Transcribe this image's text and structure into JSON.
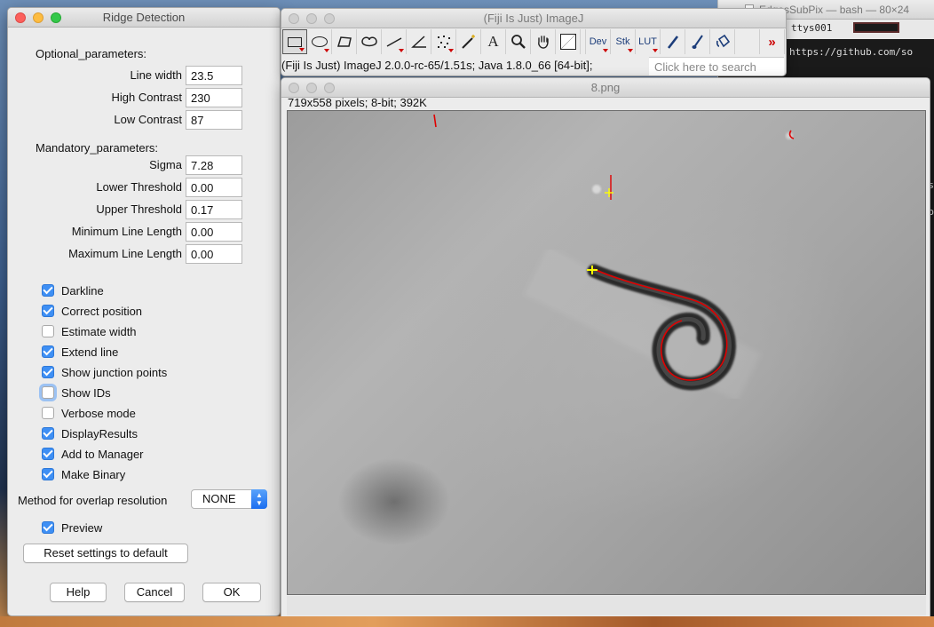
{
  "terminal": {
    "title": "EdgesSubPix — bash — 80×24",
    "tab": "ttys001",
    "url_fragment": "https://github.com/so",
    "caret1": "s",
    "caret2": "o"
  },
  "dialog": {
    "title": "Ridge Detection",
    "optional_label": "Optional_parameters:",
    "optional": [
      {
        "label": "Line width",
        "value": "23.5"
      },
      {
        "label": "High Contrast",
        "value": "230"
      },
      {
        "label": "Low Contrast",
        "value": "87"
      }
    ],
    "mandatory_label": "Mandatory_parameters:",
    "mandatory": [
      {
        "label": "Sigma",
        "value": "7.28"
      },
      {
        "label": "Lower Threshold",
        "value": "0.00"
      },
      {
        "label": "Upper Threshold",
        "value": "0.17"
      },
      {
        "label": "Minimum Line Length",
        "value": "0.00"
      },
      {
        "label": "Maximum Line Length",
        "value": "0.00"
      }
    ],
    "checkboxes": [
      {
        "label": "Darkline",
        "checked": true
      },
      {
        "label": "Correct position",
        "checked": true
      },
      {
        "label": "Estimate width",
        "checked": false
      },
      {
        "label": "Extend line",
        "checked": true
      },
      {
        "label": "Show junction points",
        "checked": true
      },
      {
        "label": "Show IDs",
        "checked": false
      },
      {
        "label": "Verbose mode",
        "checked": false
      },
      {
        "label": "DisplayResults",
        "checked": true
      },
      {
        "label": "Add to Manager",
        "checked": true
      },
      {
        "label": "Make Binary",
        "checked": true
      }
    ],
    "method_label": "Method for overlap resolution",
    "method_value": "NONE",
    "preview_label": "Preview",
    "reset_label": "Reset settings to default",
    "help_label": "Help",
    "cancel_label": "Cancel",
    "ok_label": "OK"
  },
  "imagej": {
    "title": "(Fiji Is Just) ImageJ",
    "status": "(Fiji Is Just) ImageJ 2.0.0-rc-65/1.51s; Java 1.8.0_66 [64-bit];",
    "search_placeholder": "Click here to search",
    "tools": [
      {
        "name": "rectangle-tool-icon",
        "glyph": "▭",
        "selected": true
      },
      {
        "name": "oval-tool-icon",
        "glyph": "◯"
      },
      {
        "name": "polygon-tool-icon",
        "glyph": "⬠"
      },
      {
        "name": "freehand-tool-icon",
        "glyph": "〰"
      },
      {
        "name": "line-tool-icon",
        "glyph": "╱"
      },
      {
        "name": "angle-tool-icon",
        "glyph": "∠"
      },
      {
        "name": "point-tool-icon",
        "glyph": "✚"
      },
      {
        "name": "wand-tool-icon",
        "glyph": "⚚"
      },
      {
        "name": "text-tool-icon",
        "glyph": "A"
      },
      {
        "name": "magnifier-tool-icon",
        "glyph": "🔍"
      },
      {
        "name": "hand-tool-icon",
        "glyph": "✋"
      },
      {
        "name": "color-picker-icon",
        "glyph": "▢"
      },
      {
        "name": "dev-menu-icon",
        "glyph": "Dev"
      },
      {
        "name": "stk-menu-icon",
        "glyph": "Stk"
      },
      {
        "name": "lut-menu-icon",
        "glyph": "LUT"
      },
      {
        "name": "pencil-tool-icon",
        "glyph": "✎"
      },
      {
        "name": "brush-tool-icon",
        "glyph": "🖌"
      },
      {
        "name": "flood-fill-tool-icon",
        "glyph": "⛾"
      },
      {
        "name": "blank-tool-icon",
        "glyph": ""
      },
      {
        "name": "more-tools-icon",
        "glyph": "≫"
      }
    ]
  },
  "image_window": {
    "title": "8.png",
    "info": "719x558 pixels; 8-bit; 392K"
  },
  "colors": {
    "accent_blue": "#3e8ff4",
    "ridge_red": "#e00000"
  }
}
